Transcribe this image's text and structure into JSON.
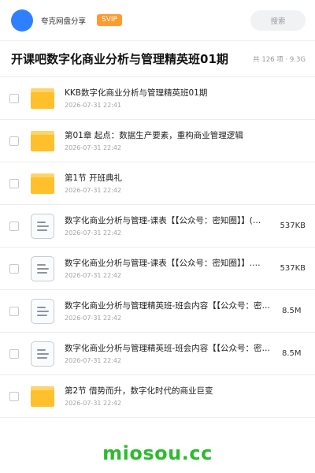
{
  "header": {
    "user_name": "夸克网盘分享",
    "badge": "SVIP",
    "search_placeholder": "搜索"
  },
  "folder": {
    "title": "开课吧数字化商业分析与管理精英班01期",
    "count": "共 126 项 · 9.3G"
  },
  "items": [
    {
      "type": "folder",
      "name": "KKB数字化商业分析与管理精英班01期",
      "date": "2026-07-31 22:41",
      "size": ""
    },
    {
      "type": "folder",
      "name": "第01章 起点：数据生产要素，重构商业管理逻辑",
      "date": "2026-07-31 22:42",
      "size": ""
    },
    {
      "type": "folder",
      "name": "第1节  开班典礼",
      "date": "2026-07-31 22:42",
      "size": ""
    },
    {
      "type": "file",
      "name": "数字化商业分析与管理-课表【【公众号：密知圈】】(…",
      "date": "2026-07-31 22:42",
      "size": "537KB"
    },
    {
      "type": "file",
      "name": "数字化商业分析与管理-课表【【公众号：密知圈】】.…",
      "date": "2026-07-31 22:42",
      "size": "537KB"
    },
    {
      "type": "file",
      "name": "数字化商业分析与管理精英班-班会内容【【公众号：密…",
      "date": "2026-07-31 22:42",
      "size": "8.5M"
    },
    {
      "type": "file",
      "name": "数字化商业分析与管理精英班-班会内容【【公众号：密…",
      "date": "2026-07-31 22:42",
      "size": "8.5M"
    },
    {
      "type": "folder",
      "name": "第2节  借势而升，数字化时代的商业巨变",
      "date": "2026-07-31 22:42",
      "size": ""
    }
  ],
  "watermark": "miosou.cc",
  "colors": {
    "avatar": "#2f80ff",
    "badge": "#ff9a2f",
    "folder": "#ffc02b",
    "watermark": "#2dbb2d"
  }
}
